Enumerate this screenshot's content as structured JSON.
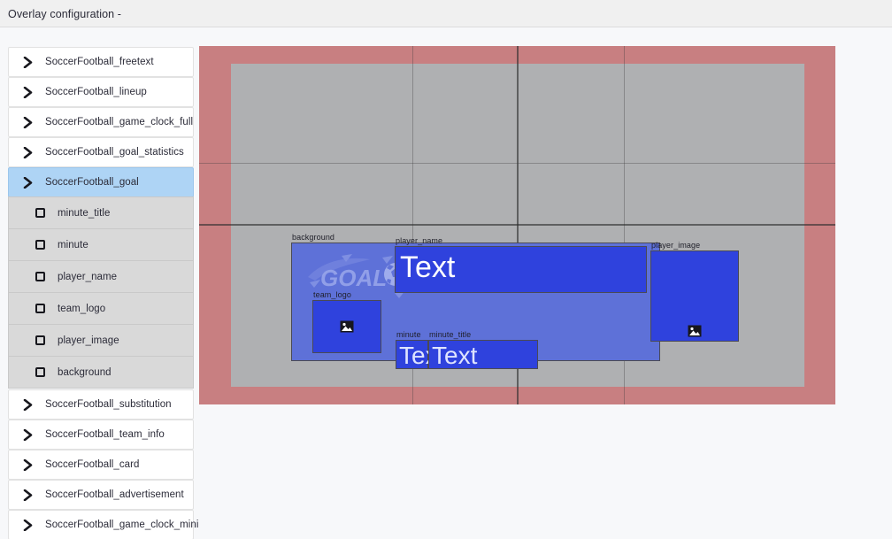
{
  "header": {
    "title": "Overlay configuration -"
  },
  "sidebar": {
    "items": [
      {
        "label": "SoccerFootball_freetext",
        "type": "group",
        "icon": "chevron-right-icon",
        "selected": false
      },
      {
        "label": "SoccerFootball_lineup",
        "type": "group",
        "icon": "chevron-right-icon",
        "selected": false
      },
      {
        "label": "SoccerFootball_game_clock_full",
        "type": "group",
        "icon": "chevron-right-icon",
        "selected": false
      },
      {
        "label": "SoccerFootball_goal_statistics",
        "type": "group",
        "icon": "chevron-right-icon",
        "selected": false
      },
      {
        "label": "SoccerFootball_goal",
        "type": "group",
        "icon": "chevron-right-icon",
        "selected": true
      },
      {
        "label": "minute_title",
        "type": "child",
        "icon": "square-icon",
        "selected": false
      },
      {
        "label": "minute",
        "type": "child",
        "icon": "square-icon",
        "selected": false
      },
      {
        "label": "player_name",
        "type": "child",
        "icon": "square-icon",
        "selected": false
      },
      {
        "label": "team_logo",
        "type": "child",
        "icon": "square-icon",
        "selected": false
      },
      {
        "label": "player_image",
        "type": "child",
        "icon": "square-icon",
        "selected": false
      },
      {
        "label": "background",
        "type": "child",
        "icon": "square-icon",
        "selected": false
      },
      {
        "label": "SoccerFootball_substitution",
        "type": "group",
        "icon": "chevron-right-icon",
        "selected": false
      },
      {
        "label": "SoccerFootball_team_info",
        "type": "group",
        "icon": "chevron-right-icon",
        "selected": false
      },
      {
        "label": "SoccerFootball_card",
        "type": "group",
        "icon": "chevron-right-icon",
        "selected": false
      },
      {
        "label": "SoccerFootball_advertisement",
        "type": "group",
        "icon": "chevron-right-icon",
        "selected": false
      },
      {
        "label": "SoccerFootball_game_clock_mini",
        "type": "group",
        "icon": "chevron-right-icon",
        "selected": false
      }
    ]
  },
  "canvas": {
    "colors": {
      "outside_safe_area": "#c87f81",
      "safe_area": "#afb0b2",
      "widget_background": "#5e71d8",
      "widget_box": "#2f42dd",
      "widget_border": "#4a4a55",
      "selection_blue": "#aed4f5"
    },
    "watermark_text": "GOAL",
    "widgets": [
      {
        "name": "background",
        "label": "background",
        "kind": "panel"
      },
      {
        "name": "player_name",
        "label": "player_name",
        "kind": "text",
        "value": "Text"
      },
      {
        "name": "player_image",
        "label": "player_image",
        "kind": "image"
      },
      {
        "name": "team_logo",
        "label": "team_logo",
        "kind": "image"
      },
      {
        "name": "minute",
        "label": "minute",
        "kind": "text",
        "value": "Text"
      },
      {
        "name": "minute_title",
        "label": "minute_title",
        "kind": "text",
        "value": "Text"
      }
    ]
  }
}
